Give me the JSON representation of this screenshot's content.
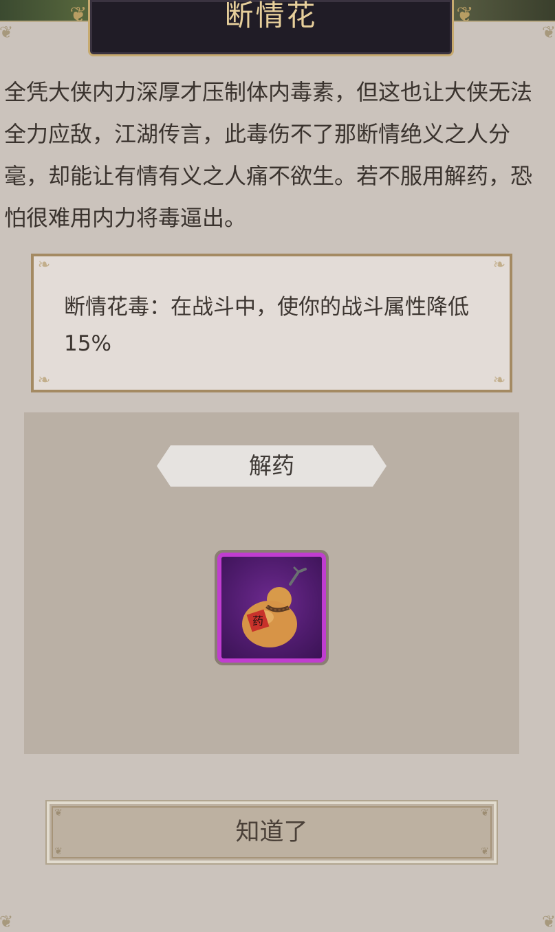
{
  "popup": {
    "title": "断情花",
    "description": "全凭大侠内力深厚才压制体内毒素，但这也让大侠无法全力应敌，江湖传言，此毒伤不了那断情绝义之人分毫，却能让有情有义之人痛不欲生。若不服用解药，恐怕很难用内力将毒逼出。",
    "effect_text": "断情花毒：在战斗中，使你的战斗属性降低15%",
    "antidote_label": "解药",
    "item": {
      "icon": "gourd-medicine-icon",
      "rarity_color": "#c03dd0",
      "tag_text": "药"
    },
    "confirm_label": "知道了"
  },
  "colors": {
    "title_plate": "#201c26",
    "title_text": "#e7cf9b",
    "panel_bg": "#cbc3bc",
    "frame_gold": "#a48a62"
  }
}
